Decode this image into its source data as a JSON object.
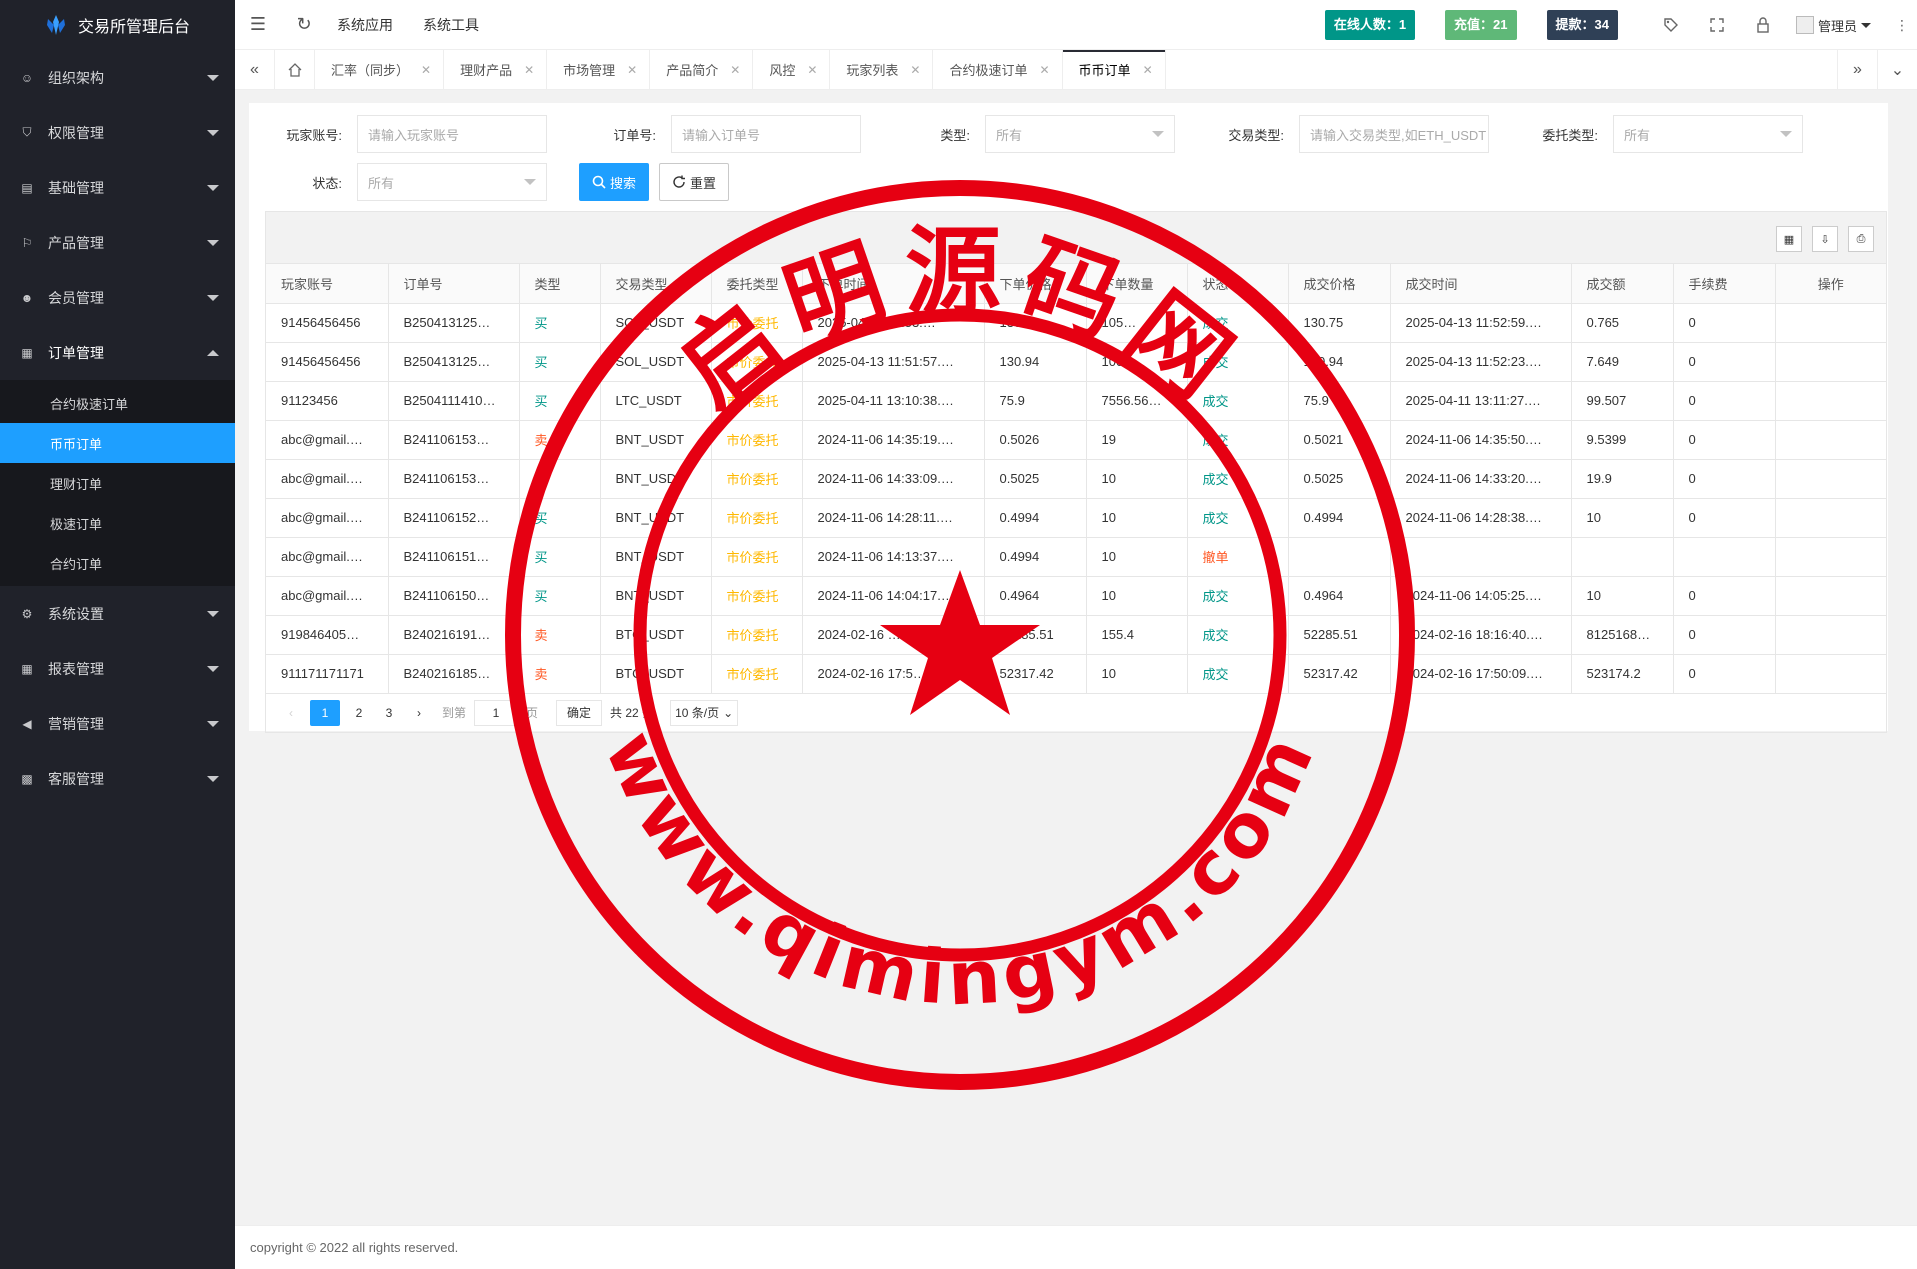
{
  "app": {
    "title": "交易所管理后台"
  },
  "sidebar": {
    "groups_top": [
      {
        "label": "组织架构",
        "icon": "user-icon"
      },
      {
        "label": "权限管理",
        "icon": "shield-icon"
      },
      {
        "label": "基础管理",
        "icon": "database-icon"
      },
      {
        "label": "产品管理",
        "icon": "flag-icon"
      },
      {
        "label": "会员管理",
        "icon": "member-icon"
      }
    ],
    "open_group": {
      "label": "订单管理",
      "icon": "grid-icon"
    },
    "sub_items": [
      "合约极速订单",
      "币币订单",
      "理财订单",
      "极速订单",
      "合约订单"
    ],
    "active_sub": 1,
    "groups_bottom": [
      {
        "label": "系统设置",
        "icon": "gear-icon"
      },
      {
        "label": "报表管理",
        "icon": "report-icon"
      },
      {
        "label": "营销管理",
        "icon": "megaphone-icon"
      },
      {
        "label": "客服管理",
        "icon": "support-icon"
      }
    ]
  },
  "header": {
    "menu": [
      "系统应用",
      "系统工具"
    ],
    "online_badge": "在线人数：1",
    "recharge_badge": "充值：21",
    "withdraw_badge": "提款：34",
    "user_label": "管理员",
    "colors": {
      "online": "#009688",
      "recharge": "#5fb878",
      "withdraw": "#2f4056"
    }
  },
  "tabs": {
    "items": [
      "汇率（同步）",
      "理财产品",
      "市场管理",
      "产品简介",
      "风控",
      "玩家列表",
      "合约极速订单",
      "币币订单"
    ],
    "active": 7
  },
  "filters": {
    "account": {
      "label": "玩家账号:",
      "placeholder": "请输入玩家账号"
    },
    "order_no": {
      "label": "订单号:",
      "placeholder": "请输入订单号"
    },
    "type": {
      "label": "类型:",
      "value": "所有"
    },
    "trade_type": {
      "label": "交易类型:",
      "placeholder": "请输入交易类型,如ETH_USDT"
    },
    "entrust_type": {
      "label": "委托类型:",
      "value": "所有"
    },
    "status": {
      "label": "状态:",
      "value": "所有"
    },
    "search_label": "搜索",
    "reset_label": "重置"
  },
  "table": {
    "columns": [
      "玩家账号",
      "订单号",
      "类型",
      "交易类型",
      "委托类型",
      "下单时间",
      "下单价格",
      "下单数量",
      "状态",
      "成交价格",
      "成交时间",
      "成交额",
      "手续费",
      "操作"
    ],
    "rows": [
      [
        "91456456456",
        "B250413125…",
        "买",
        "SOL_USDT",
        "市价委托",
        "2025-04-13 11:53:…",
        "130.75",
        "105…",
        "成交",
        "130.75",
        "2025-04-13 11:52:59.…",
        "0.765",
        "0",
        ""
      ],
      [
        "91456456456",
        "B250413125…",
        "买",
        "SOL_USDT",
        "市价委托",
        "2025-04-13 11:51:57.…",
        "130.94",
        "1000",
        "成交",
        "130.94",
        "2025-04-13 11:52:23.…",
        "7.649",
        "0",
        ""
      ],
      [
        "91123456",
        "B2504111410…",
        "买",
        "LTC_USDT",
        "市价委托",
        "2025-04-11 13:10:38.…",
        "75.9",
        "7556.56…",
        "成交",
        "75.9",
        "2025-04-11 13:11:27.…",
        "99.507",
        "0",
        ""
      ],
      [
        "abc@gmail.…",
        "B241106153…",
        "卖",
        "BNT_USDT",
        "市价委托",
        "2024-11-06 14:35:19.…",
        "0.5026",
        "19",
        "成交",
        "0.5021",
        "2024-11-06 14:35:50.…",
        "9.5399",
        "0",
        ""
      ],
      [
        "abc@gmail.…",
        "B241106153…",
        "卖",
        "BNT_USDT",
        "市价委托",
        "2024-11-06 14:33:09.…",
        "0.5025",
        "10",
        "成交",
        "0.5025",
        "2024-11-06 14:33:20.…",
        "19.9",
        "0",
        ""
      ],
      [
        "abc@gmail.…",
        "B241106152…",
        "买",
        "BNT_USDT",
        "市价委托",
        "2024-11-06 14:28:11.…",
        "0.4994",
        "10",
        "成交",
        "0.4994",
        "2024-11-06 14:28:38.…",
        "10",
        "0",
        ""
      ],
      [
        "abc@gmail.…",
        "B241106151…",
        "买",
        "BNT_USDT",
        "市价委托",
        "2024-11-06 14:13:37.…",
        "0.4994",
        "10",
        "撤单",
        "",
        "",
        "",
        "",
        ""
      ],
      [
        "abc@gmail.…",
        "B241106150…",
        "买",
        "BNT_USDT",
        "市价委托",
        "2024-11-06 14:04:17.…",
        "0.4964",
        "10",
        "成交",
        "0.4964",
        "2024-11-06 14:05:25.…",
        "10",
        "0",
        ""
      ],
      [
        "919846405…",
        "B240216191…",
        "卖",
        "BTC_USDT",
        "市价委托",
        "2024-02-16 …",
        "52285.51",
        "155.4",
        "成交",
        "52285.51",
        "2024-02-16 18:16:40.…",
        "8125168…",
        "0",
        ""
      ],
      [
        "911171171171",
        "B240216185…",
        "卖",
        "BTC_USDT",
        "市价委托",
        "2024-02-16 17:5…",
        "52317.42",
        "10",
        "成交",
        "52317.42",
        "2024-02-16 17:50:09.…",
        "523174.2",
        "0",
        ""
      ]
    ]
  },
  "pager": {
    "pages": [
      "1",
      "2",
      "3"
    ],
    "current": "1",
    "goto_label": "到第",
    "goto_value": "1",
    "page_unit": "页",
    "confirm_label": "确定",
    "total_label": "共 22 条",
    "size_label": "10 条/页"
  },
  "footer": {
    "copyright": "copyright © 2022 all rights reserved."
  },
  "watermark": {
    "top_text": "启明源码网",
    "bottom_text": "www.qimingym.com",
    "color": "#e60012"
  }
}
